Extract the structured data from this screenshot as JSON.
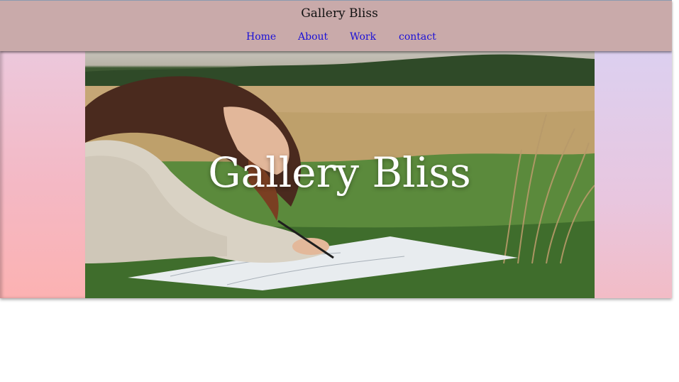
{
  "header": {
    "title": "Gallery Bliss",
    "nav": [
      {
        "label": "Home"
      },
      {
        "label": "About"
      },
      {
        "label": "Work"
      },
      {
        "label": "contact"
      }
    ]
  },
  "hero": {
    "title": "Gallery Bliss",
    "image": "girl-drawing-in-field",
    "colors": {
      "header_bg": "#c9aaaa",
      "nav_link": "#1a10d8",
      "left_panel": "#f4b8c4",
      "right_panel": "#e8c6df"
    }
  }
}
